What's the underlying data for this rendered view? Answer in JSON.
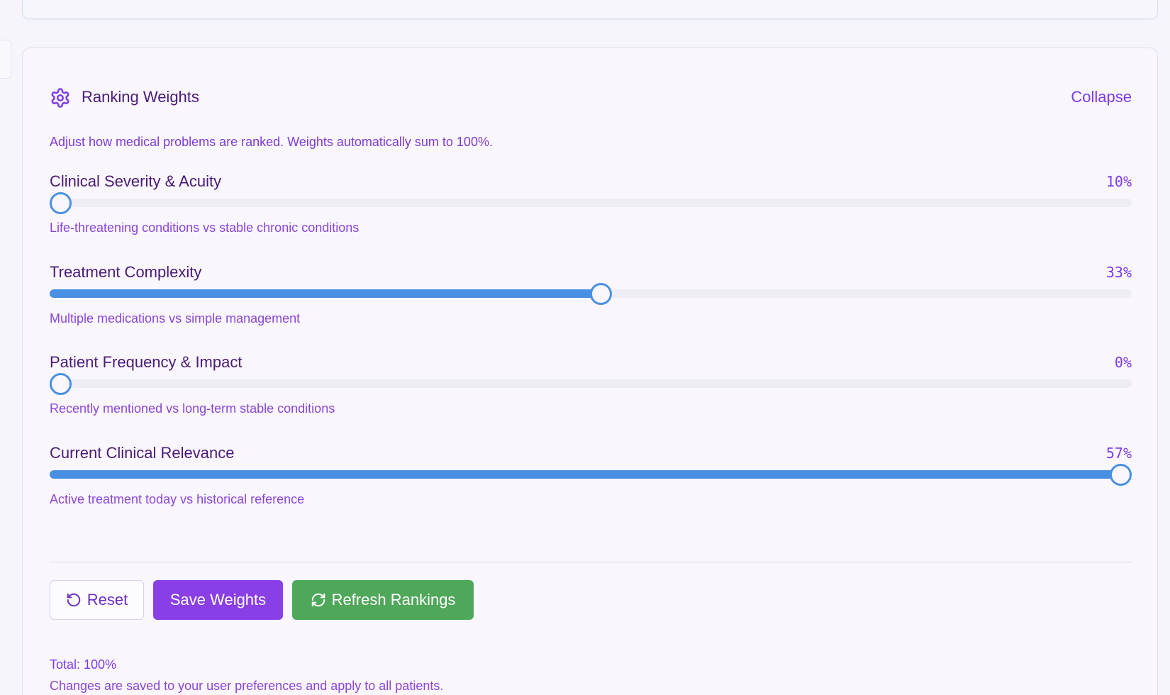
{
  "panel": {
    "title": "Ranking Weights",
    "collapse_label": "Collapse",
    "description": "Adjust how medical problems are ranked. Weights automatically sum to 100%."
  },
  "sliders": [
    {
      "label": "Clinical Severity & Acuity",
      "value_text": "10%",
      "value": 0.1,
      "fill_fraction": 0.0,
      "help": "Life-threatening conditions vs stable chronic conditions"
    },
    {
      "label": "Treatment Complexity",
      "value_text": "33%",
      "value": 0.33,
      "fill_fraction": 0.51,
      "help": "Multiple medications vs simple management"
    },
    {
      "label": "Patient Frequency & Impact",
      "value_text": "0%",
      "value": 0.0,
      "fill_fraction": 0.0,
      "help": "Recently mentioned vs long-term stable conditions"
    },
    {
      "label": "Current Clinical Relevance",
      "value_text": "57%",
      "value": 0.57,
      "fill_fraction": 1.0,
      "help": "Active treatment today vs historical reference"
    }
  ],
  "actions": {
    "reset_label": "Reset",
    "save_label": "Save Weights",
    "refresh_label": "Refresh Rankings"
  },
  "footer": {
    "total": "Total: 100%",
    "note": "Changes are saved to your user preferences and apply to all patients."
  },
  "colors": {
    "accent": "#7c3aed",
    "slider": "#4a90e2",
    "save_button": "#8a3ee6",
    "refresh_button": "#4fa759"
  }
}
